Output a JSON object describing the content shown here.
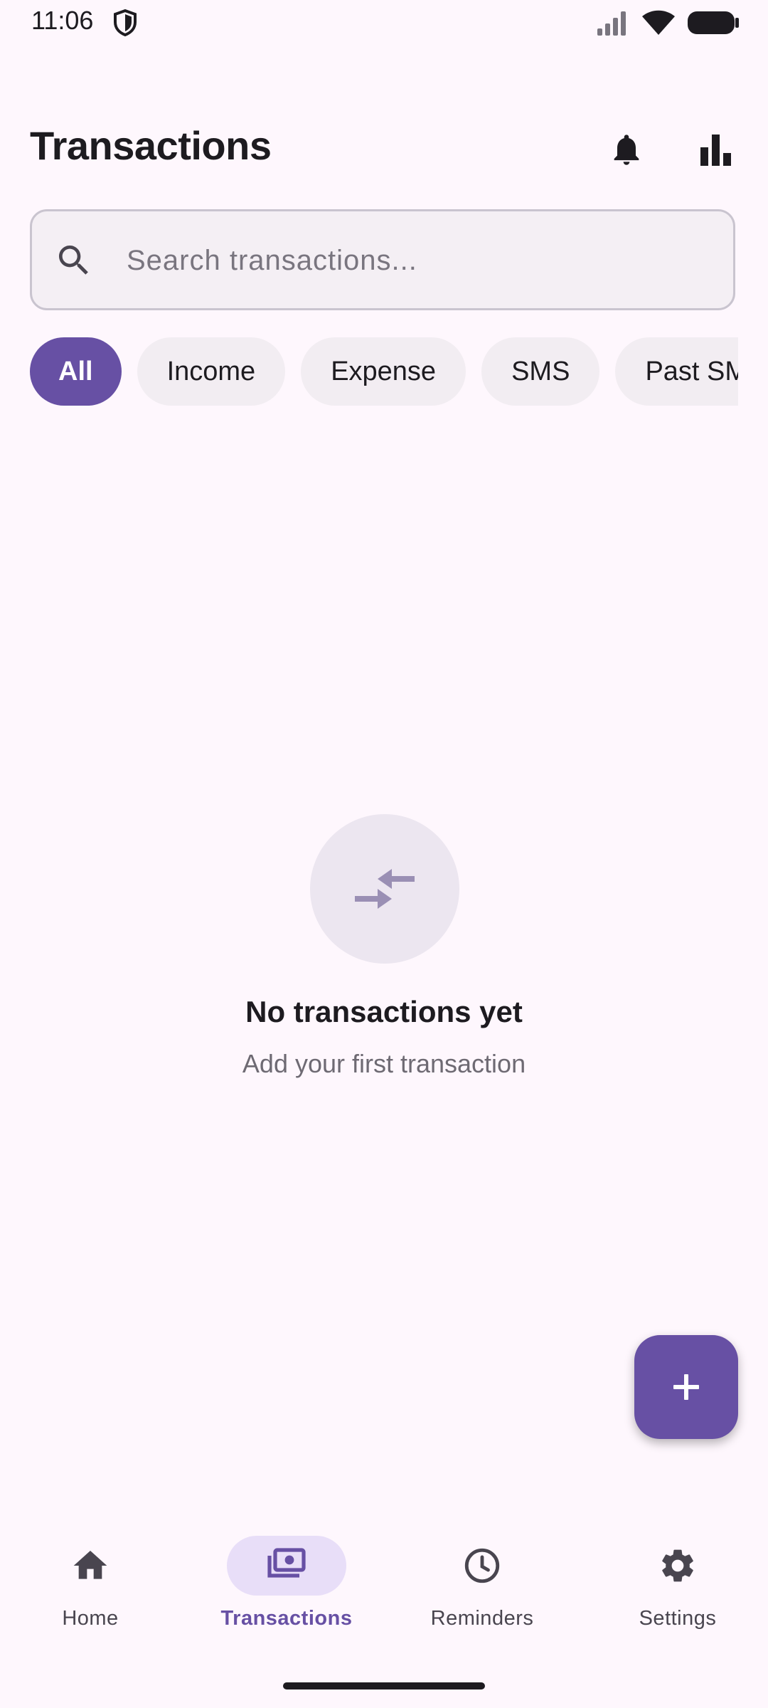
{
  "status_bar": {
    "time": "11:06",
    "icons": [
      "shield-icon",
      "signal-icon",
      "wifi-icon",
      "battery-icon"
    ]
  },
  "header": {
    "title": "Transactions",
    "actions": [
      "bell-icon",
      "bar-chart-icon"
    ]
  },
  "search": {
    "value": "",
    "placeholder": "Search transactions..."
  },
  "filters": {
    "selected": "All",
    "chips": [
      "All",
      "Income",
      "Expense",
      "SMS",
      "Past SMS"
    ]
  },
  "empty_state": {
    "icon": "compare-arrows-icon",
    "title": "No transactions yet",
    "subtitle": "Add your first transaction"
  },
  "fab": {
    "icon": "plus-icon"
  },
  "bottom_nav": {
    "active": "Transactions",
    "items": [
      {
        "label": "Home",
        "icon": "home-icon"
      },
      {
        "label": "Transactions",
        "icon": "payments-icon"
      },
      {
        "label": "Reminders",
        "icon": "clock-icon"
      },
      {
        "label": "Settings",
        "icon": "gear-icon"
      }
    ]
  },
  "colors": {
    "background": "#FEF7FD",
    "primary": "#6750A4",
    "secondary_container": "#E8DEF8",
    "chip_background": "#F2EDF2",
    "on_surface": "#1D1B20"
  }
}
